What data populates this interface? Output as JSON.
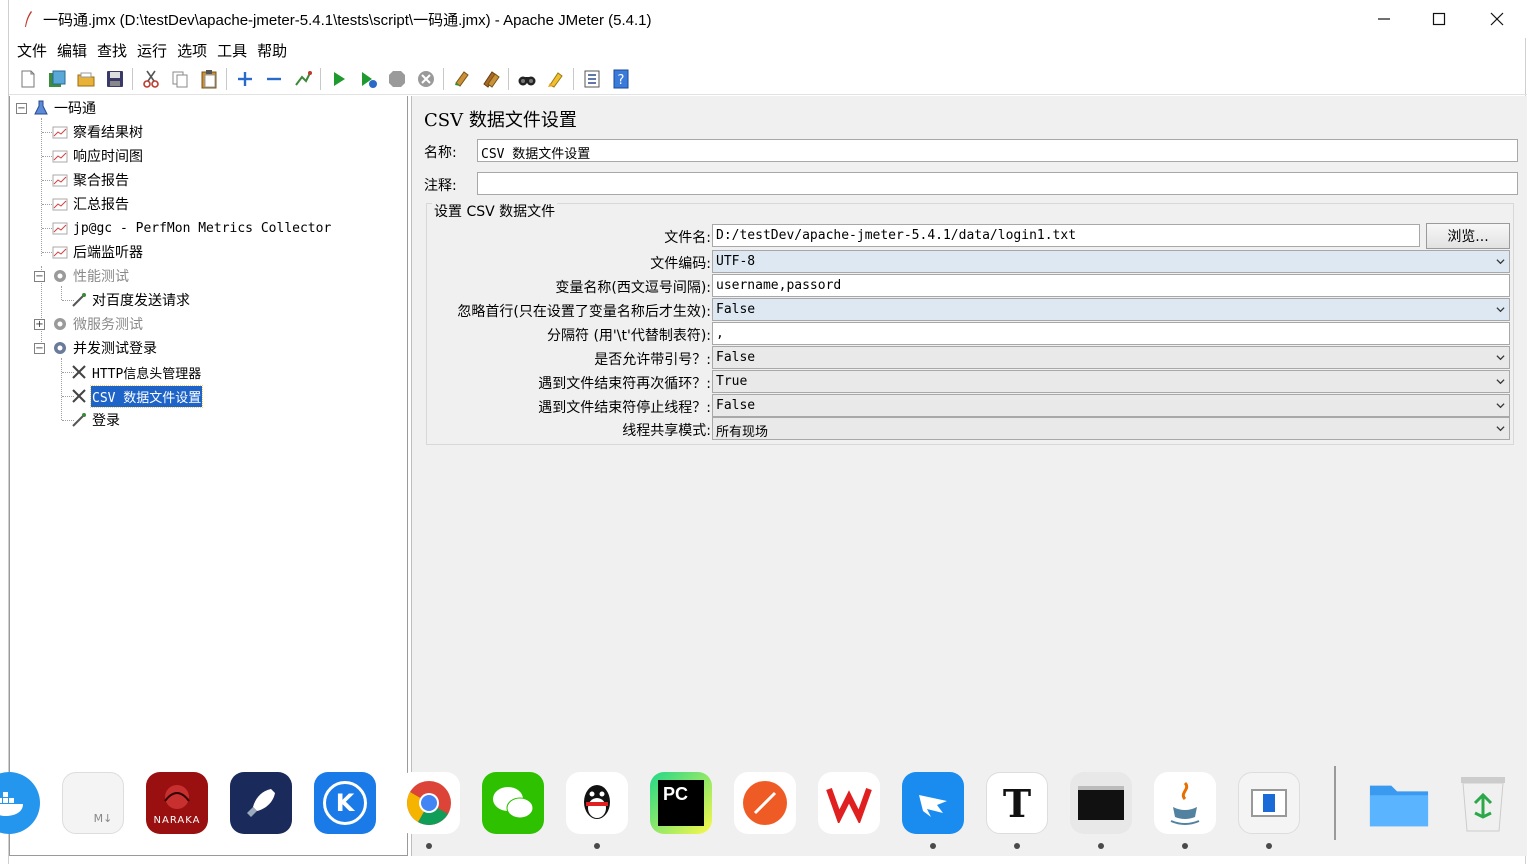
{
  "window": {
    "title": "一码通.jmx (D:\\testDev\\apache-jmeter-5.4.1\\tests\\script\\一码通.jmx) - Apache JMeter (5.4.1)",
    "controls": [
      "minimize-icon",
      "maximize-icon",
      "close-icon"
    ]
  },
  "menubar": {
    "items": [
      "文件",
      "编辑",
      "查找",
      "运行",
      "选项",
      "工具",
      "帮助"
    ]
  },
  "toolbar": {
    "icons": [
      "new-icon",
      "templates-icon",
      "open-icon",
      "save-icon",
      "cut-icon",
      "copy-icon",
      "paste-icon",
      "expand-icon",
      "collapse-icon",
      "toggle-icon",
      "start-icon",
      "start-no-pause-icon",
      "stop-icon",
      "shutdown-icon",
      "clear-icon",
      "clear-all-icon",
      "search-icon",
      "reset-search-icon",
      "function-helper-icon",
      "help-icon"
    ]
  },
  "tree": {
    "root": "一码通",
    "listeners": [
      "察看结果树",
      "响应时间图",
      "聚合报告",
      "汇总报告",
      "jp@gc - PerfMon Metrics Collector",
      "后端监听器"
    ],
    "group1": "性能测试",
    "group1_child": "对百度发送请求",
    "group2": "微服务测试",
    "group3": "并发测试登录",
    "group3_children": [
      "HTTP信息头管理器",
      "CSV 数据文件设置",
      "登录"
    ]
  },
  "panel": {
    "title": "CSV 数据文件设置",
    "name_label": "名称:",
    "name_value": "CSV 数据文件设置",
    "comment_label": "注释:",
    "comment_value": "",
    "group_title": "设置 CSV 数据文件",
    "browse_label": "浏览...",
    "props": [
      {
        "label": "文件名:",
        "value": "D:/testDev/apache-jmeter-5.4.1/data/login1.txt"
      },
      {
        "label": "文件编码:",
        "value": "UTF-8"
      },
      {
        "label": "变量名称(西文逗号间隔):",
        "value": "username,passord"
      },
      {
        "label": "忽略首行(只在设置了变量名称后才生效):",
        "value": "False"
      },
      {
        "label": "分隔符 (用'\\t'代替制表符):",
        "value": ","
      },
      {
        "label": "是否允许带引号？:",
        "value": "False"
      },
      {
        "label": "遇到文件结束符再次循环？:",
        "value": "True"
      },
      {
        "label": "遇到文件结束符停止线程？:",
        "value": "False"
      },
      {
        "label": "线程共享模式:",
        "value": "所有现场"
      }
    ]
  },
  "dock": {
    "apps": [
      "docker-icon",
      "markdown-file-icon",
      "naraka-icon",
      "rocket-app-icon",
      "k-app-icon",
      "chrome-icon",
      "wechat-icon",
      "qq-icon",
      "pycharm-icon",
      "postman-icon",
      "wps-icon",
      "dingtalk-icon",
      "typora-icon",
      "terminal-icon",
      "java-icon",
      "window-app-icon",
      "folder-icon",
      "recycle-bin-icon"
    ],
    "naraka_text": "NARAKA",
    "pc_text": "PC",
    "t_text": "T",
    "md_text": "M↓",
    "k_text": "K"
  }
}
